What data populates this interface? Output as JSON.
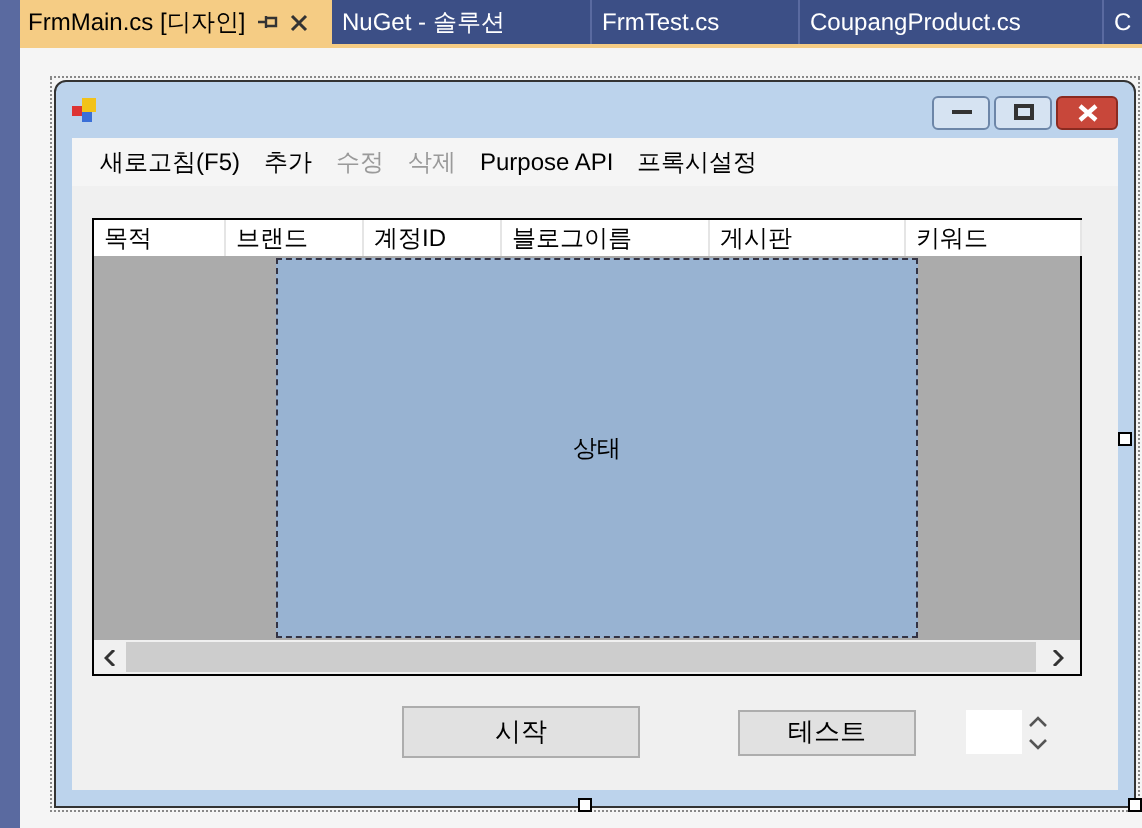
{
  "tabs": [
    {
      "label": "FrmMain.cs [디자인]",
      "selected": true
    },
    {
      "label": "NuGet - 솔루션",
      "selected": false
    },
    {
      "label": "FrmTest.cs",
      "selected": false
    },
    {
      "label": "CoupangProduct.cs",
      "selected": false
    },
    {
      "label": "C",
      "selected": false
    }
  ],
  "form": {
    "menu": [
      {
        "label": "새로고침(F5)",
        "disabled": false
      },
      {
        "label": "추가",
        "disabled": false
      },
      {
        "label": "수정",
        "disabled": true
      },
      {
        "label": "삭제",
        "disabled": true
      },
      {
        "label": "Purpose API",
        "disabled": false
      },
      {
        "label": "프록시설정",
        "disabled": false
      }
    ],
    "grid": {
      "columns": [
        "목적",
        "브랜드",
        "계정ID",
        "블로그이름",
        "게시판",
        "키워드"
      ]
    },
    "status_panel": {
      "label": "상태"
    },
    "buttons": [
      "시작",
      "테스트"
    ]
  }
}
